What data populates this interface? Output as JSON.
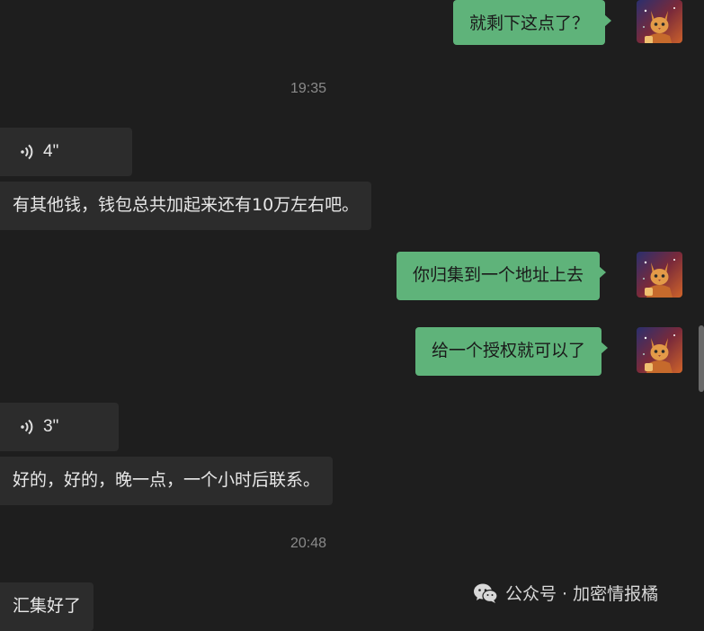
{
  "messages": {
    "m1": "就剩下这点了？",
    "t1": "19:35",
    "v1": "4\"",
    "m2": "有其他钱，钱包总共加起来还有10万左右吧。",
    "m3": "你归集到一个地址上去",
    "m4": "给一个授权就可以了",
    "v2": "3\"",
    "m5": "好的，好的，晚一点，一个小时后联系。",
    "t2": "20:48",
    "m6": "汇集好了"
  },
  "watermark": {
    "text": "公众号 · 加密情报橘"
  },
  "colors": {
    "background": "#1e1e1e",
    "incoming_bubble": "#2c2c2c",
    "outgoing_bubble": "#5fb37a",
    "timestamp": "#8a8a8a"
  },
  "icons": {
    "voice": "voice-wave-icon",
    "avatar": "cat-avatar-icon",
    "watermark": "wechat-icon"
  }
}
